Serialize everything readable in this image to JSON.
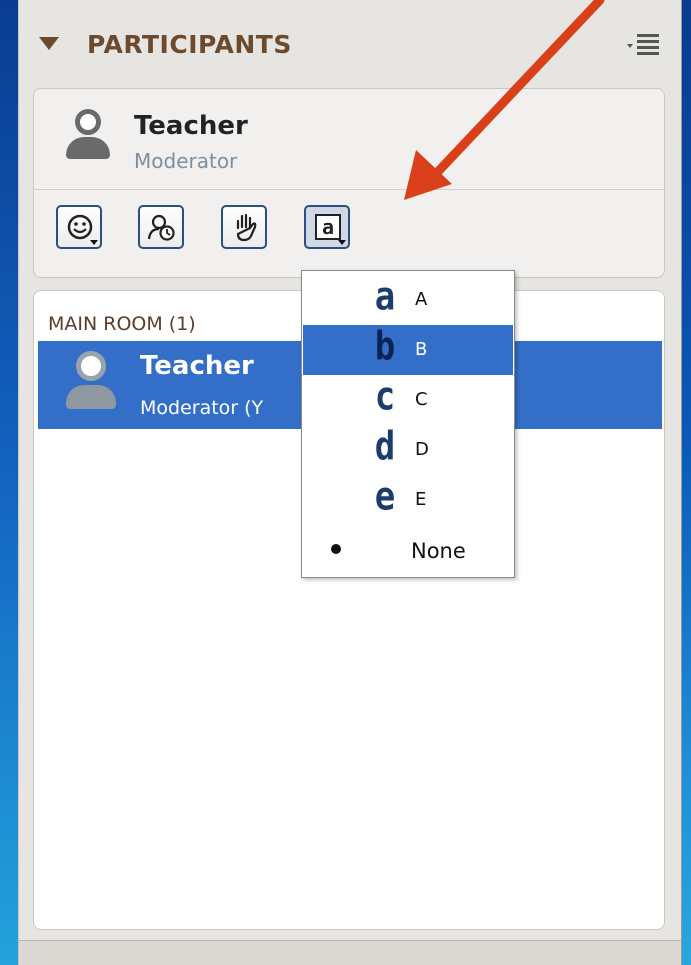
{
  "panel": {
    "title": "PARTICIPANTS",
    "icons": [
      "collapse-triangle-icon",
      "panel-options-icon"
    ]
  },
  "current_user": {
    "name": "Teacher",
    "role": "Moderator"
  },
  "toolbar": {
    "buttons": [
      {
        "icon": "emoticon-icon"
      },
      {
        "icon": "away-status-icon"
      },
      {
        "icon": "raise-hand-icon"
      },
      {
        "icon": "answer-icon"
      }
    ]
  },
  "room": {
    "title": "MAIN ROOM (1)",
    "participants": [
      {
        "name": "Teacher",
        "role": "Moderator (Y"
      }
    ]
  },
  "answer_menu": {
    "selected": "B",
    "items": [
      {
        "glyph": "a",
        "label": "A"
      },
      {
        "glyph": "b",
        "label": "B"
      },
      {
        "glyph": "c",
        "label": "C"
      },
      {
        "glyph": "d",
        "label": "D"
      },
      {
        "glyph": "e",
        "label": "E"
      },
      {
        "glyph": "",
        "label": "None"
      }
    ]
  },
  "colors": {
    "accent_brown": "#6b4a2e",
    "selection_blue": "#336fc9",
    "annotation_arrow": "#d9401a",
    "background_blue": "#0b58b8"
  }
}
